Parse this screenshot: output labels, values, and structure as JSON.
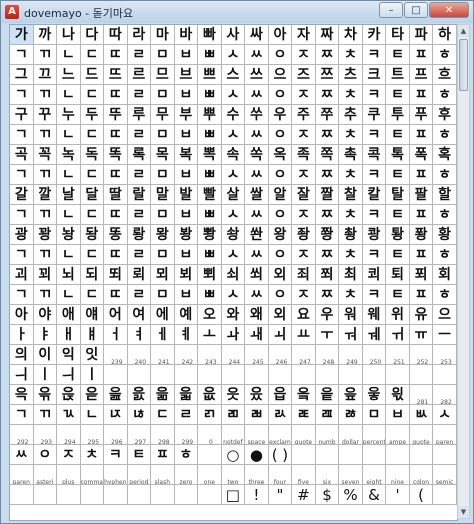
{
  "window": {
    "title": "dovemayo - 돋기마요",
    "controls": [
      "–",
      "□",
      "✕"
    ]
  },
  "rows": [
    [
      "가",
      "까",
      "나",
      "다",
      "따",
      "라",
      "마",
      "바",
      "빠",
      "사",
      "싸",
      "아",
      "자",
      "짜",
      "차",
      "카",
      "타",
      "파",
      "하"
    ],
    [
      "ㄱ",
      "ㄲ",
      "ㄴ",
      "ㄷ",
      "ㄸ",
      "ㄹ",
      "ㅁ",
      "ㅂ",
      "ㅃ",
      "ㅅ",
      "ㅆ",
      "ㅇ",
      "ㅈ",
      "ㅉ",
      "ㅊ",
      "ㅋ",
      "ㅌ",
      "ㅍ",
      "ㅎ"
    ],
    [
      "그",
      "끄",
      "느",
      "드",
      "뜨",
      "르",
      "므",
      "브",
      "쁘",
      "스",
      "쓰",
      "으",
      "즈",
      "쯔",
      "츠",
      "크",
      "트",
      "프",
      "흐"
    ],
    [
      "ㄱ",
      "ㄲ",
      "ㄴ",
      "ㄷ",
      "ㄸ",
      "ㄹ",
      "ㅁ",
      "ㅂ",
      "ㅃ",
      "ㅅ",
      "ㅆ",
      "ㅇ",
      "ㅈ",
      "ㅉ",
      "ㅊ",
      "ㅋ",
      "ㅌ",
      "ㅍ",
      "ㅎ"
    ],
    [
      "구",
      "꾸",
      "누",
      "두",
      "뚜",
      "루",
      "무",
      "부",
      "뿌",
      "수",
      "쑤",
      "우",
      "주",
      "쭈",
      "추",
      "쿠",
      "투",
      "푸",
      "후"
    ],
    [
      "ㄱ",
      "ㄲ",
      "ㄴ",
      "ㄷ",
      "ㄸ",
      "ㄹ",
      "ㅁ",
      "ㅂ",
      "ㅃ",
      "ㅅ",
      "ㅆ",
      "ㅇ",
      "ㅈ",
      "ㅉ",
      "ㅊ",
      "ㅋ",
      "ㅌ",
      "ㅍ",
      "ㅎ"
    ],
    [
      "곡",
      "꼭",
      "녹",
      "독",
      "똑",
      "록",
      "목",
      "복",
      "뽁",
      "속",
      "쏙",
      "옥",
      "족",
      "쪽",
      "촉",
      "콕",
      "톡",
      "폭",
      "혹"
    ],
    [
      "ㄱ",
      "ㄲ",
      "ㄴ",
      "ㄷ",
      "ㄸ",
      "ㄹ",
      "ㅁ",
      "ㅂ",
      "ㅃ",
      "ㅅ",
      "ㅆ",
      "ㅇ",
      "ㅈ",
      "ㅉ",
      "ㅊ",
      "ㅋ",
      "ㅌ",
      "ㅍ",
      "ㅎ"
    ],
    [
      "갈",
      "깔",
      "날",
      "달",
      "딸",
      "랄",
      "말",
      "발",
      "빨",
      "살",
      "쌀",
      "알",
      "잘",
      "짤",
      "찰",
      "칼",
      "탈",
      "팔",
      "할"
    ],
    [
      "ㄱ",
      "ㄲ",
      "ㄴ",
      "ㄷ",
      "ㄸ",
      "ㄹ",
      "ㅁ",
      "ㅂ",
      "ㅃ",
      "ㅅ",
      "ㅆ",
      "ㅇ",
      "ㅈ",
      "ㅉ",
      "ㅊ",
      "ㅋ",
      "ㅌ",
      "ㅍ",
      "ㅎ"
    ],
    [
      "광",
      "꽝",
      "놩",
      "돵",
      "똥",
      "뢍",
      "뫙",
      "봥",
      "뽱",
      "솽",
      "쏸",
      "왕",
      "좡",
      "쫭",
      "촹",
      "쾅",
      "퇑",
      "퐝",
      "황"
    ],
    [
      "ㄱ",
      "ㄲ",
      "ㄴ",
      "ㄷ",
      "ㄸ",
      "ㄹ",
      "ㅁ",
      "ㅂ",
      "ㅃ",
      "ㅅ",
      "ㅆ",
      "ㅇ",
      "ㅈ",
      "ㅉ",
      "ㅊ",
      "ㅋ",
      "ㅌ",
      "ㅍ",
      "ㅎ"
    ],
    [
      "괴",
      "꾀",
      "뇌",
      "되",
      "뙤",
      "뢰",
      "뫼",
      "뵈",
      "뾔",
      "쇠",
      "쐬",
      "외",
      "죄",
      "쬐",
      "최",
      "쾨",
      "퇴",
      "푀",
      "회"
    ],
    [
      "ㄱ",
      "ㄲ",
      "ㄴ",
      "ㄷ",
      "ㄸ",
      "ㄹ",
      "ㅁ",
      "ㅂ",
      "ㅃ",
      "ㅅ",
      "ㅆ",
      "ㅇ",
      "ㅈ",
      "ㅉ",
      "ㅊ",
      "ㅋ",
      "ㅌ",
      "ㅍ",
      "ㅎ"
    ],
    [
      "아",
      "야",
      "애",
      "얘",
      "어",
      "여",
      "에",
      "예",
      "오",
      "와",
      "왜",
      "외",
      "요",
      "우",
      "워",
      "웨",
      "위",
      "유",
      "으"
    ],
    [
      "ㅏ",
      "ㅑ",
      "ㅐ",
      "ㅒ",
      "ㅓ",
      "ㅕ",
      "ㅔ",
      "ㅖ",
      "ㅗ",
      "ㅘ",
      "ㅙ",
      "ㅚ",
      "ㅛ",
      "ㅜ",
      "ㅝ",
      "ㅞ",
      "ㅟ",
      "ㅠ",
      "ㅡ"
    ],
    [
      "의",
      "이",
      "익",
      "잇",
      "_239",
      "_240",
      "_241",
      "_242",
      "_243",
      "_244",
      "_245",
      "_246",
      "_247",
      "_248",
      "_249",
      "_250",
      "_251",
      "_252",
      "_253"
    ],
    [
      "ㅢ",
      "ㅣ",
      "ㅢ",
      "ㅣ",
      "",
      "",
      "",
      "",
      "",
      "",
      "",
      "",
      "",
      "",
      "",
      "",
      "",
      "",
      ""
    ],
    [
      "윽",
      "윾",
      "읁",
      "읃",
      "읊",
      "읈",
      "읆",
      "읇",
      "읎",
      "읏",
      "읐",
      "읍",
      "읔",
      "읕",
      "읖",
      "읗",
      "읛",
      "_281",
      "_282"
    ],
    [
      "ㄱ",
      "ㄲ",
      "ㄳ",
      "ㄴ",
      "ㄵ",
      "ㄶ",
      "ㄷ",
      "ㄹ",
      "ㄺ",
      "ㄻ",
      "ㄼ",
      "ㄽ",
      "ㄾ",
      "ㄿ",
      "ㅀ",
      "ㅁ",
      "ㅂ",
      "ㅄ",
      "ㅅ"
    ],
    [
      "_292",
      "_293",
      "_294",
      "_295",
      "_296",
      "_297",
      "_298",
      "_299",
      "_0",
      "notdef",
      "space",
      "exclam",
      "quote",
      "numb",
      "dollar",
      "percent",
      "ampe",
      "quote",
      "paren"
    ],
    [
      "ㅆ",
      "ㅇ",
      "ㅈ",
      "ㅊ",
      "ㅋ",
      "ㅌ",
      "ㅍ",
      "ㅎ",
      "",
      "○",
      "●",
      "( )",
      "",
      "",
      "",
      "",
      "",
      "",
      ""
    ],
    [
      "paren",
      "asteri",
      "plus",
      "comma",
      "hyphen",
      "period",
      "slash",
      "zero",
      "one",
      "two",
      "three",
      "four",
      "five",
      "six",
      "seven",
      "eight",
      "nine",
      "colon",
      "semic"
    ],
    [
      "",
      "",
      "",
      "",
      "",
      "",
      "",
      "",
      "",
      "□",
      "!",
      "\"",
      "#",
      "$",
      "%",
      "&",
      "'",
      "(",
      ""
    ]
  ]
}
